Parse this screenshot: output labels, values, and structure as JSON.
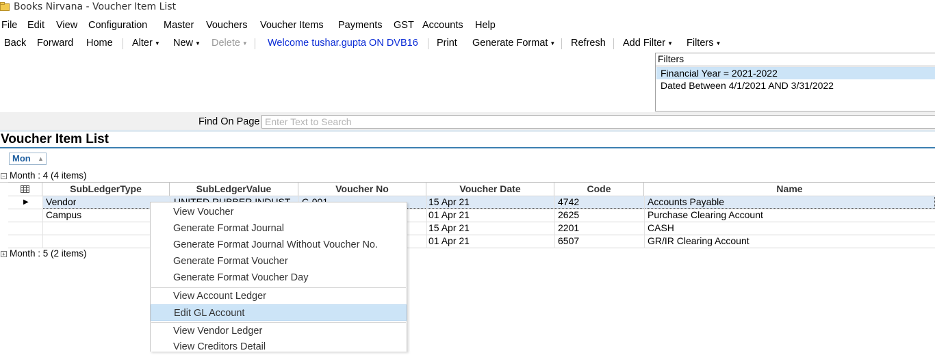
{
  "window": {
    "title": "Books Nirvana - Voucher Item List",
    "icon": "app-folder-icon"
  },
  "menu": [
    "File",
    "Edit",
    "View",
    "Configuration",
    "Master",
    "Vouchers",
    "Voucher Items",
    "Payments",
    "GST",
    "Accounts",
    "Help"
  ],
  "toolbar": {
    "back": "Back",
    "forward": "Forward",
    "home": "Home",
    "alter": "Alter",
    "new": "New",
    "delete": "Delete",
    "welcome": "Welcome tushar.gupta ON DVB16",
    "print": "Print",
    "generate_format": "Generate Format",
    "refresh": "Refresh",
    "add_filter": "Add Filter",
    "filters": "Filters",
    "dropdown_icon": "caret-down-icon"
  },
  "filters_panel": {
    "header": "Filters",
    "items": [
      "Financial Year = 2021-2022",
      "Dated Between  4/1/2021 AND 3/31/2022"
    ],
    "selected_color": "#cce4f7"
  },
  "find": {
    "label": "Find On Page",
    "placeholder": "Enter Text to Search",
    "value": ""
  },
  "page_title": "Voucher Item List",
  "group_by": {
    "label": "Mon",
    "sort_icon": "sort-up-icon"
  },
  "groups": [
    {
      "label": "Month : 4 (4 items)",
      "expanded": true
    },
    {
      "label": "Month : 5 (2 items)",
      "expanded": false
    }
  ],
  "grid": {
    "columns": [
      "SubLedgerType",
      "SubLedgerValue",
      "Voucher No",
      "Voucher Date",
      "Code",
      "Name"
    ],
    "rows": [
      {
        "subledger_type": "Vendor",
        "subledger_value": "UNITED RUBBER INDUST",
        "voucher_no": "C-001",
        "voucher_date": "15 Apr 21",
        "code": "4742",
        "name": "Accounts Payable",
        "current": true
      },
      {
        "subledger_type": "Campus",
        "subledger_value": "",
        "voucher_no": "",
        "voucher_date": "01 Apr 21",
        "code": "2625",
        "name": "Purchase Clearing Account"
      },
      {
        "subledger_type": "",
        "subledger_value": "",
        "voucher_no": "",
        "voucher_date": "15 Apr 21",
        "code": "2201",
        "name": "CASH"
      },
      {
        "subledger_type": "",
        "subledger_value": "",
        "voucher_no": "",
        "voucher_date": "01 Apr 21",
        "code": "6507",
        "name": "GR/IR Clearing Account"
      }
    ],
    "selection_color": "#dde9f6"
  },
  "context_menu": {
    "items": [
      "View Voucher",
      "Generate Format Journal",
      "Generate Format Journal Without Voucher No.",
      "Generate Format Voucher",
      "Generate Format Voucher Day",
      "View Account Ledger",
      "Edit GL Account",
      "View Vendor Ledger",
      "View Creditors Detail"
    ],
    "highlighted": "Edit GL Account",
    "highlight_color": "#cce4f7"
  }
}
